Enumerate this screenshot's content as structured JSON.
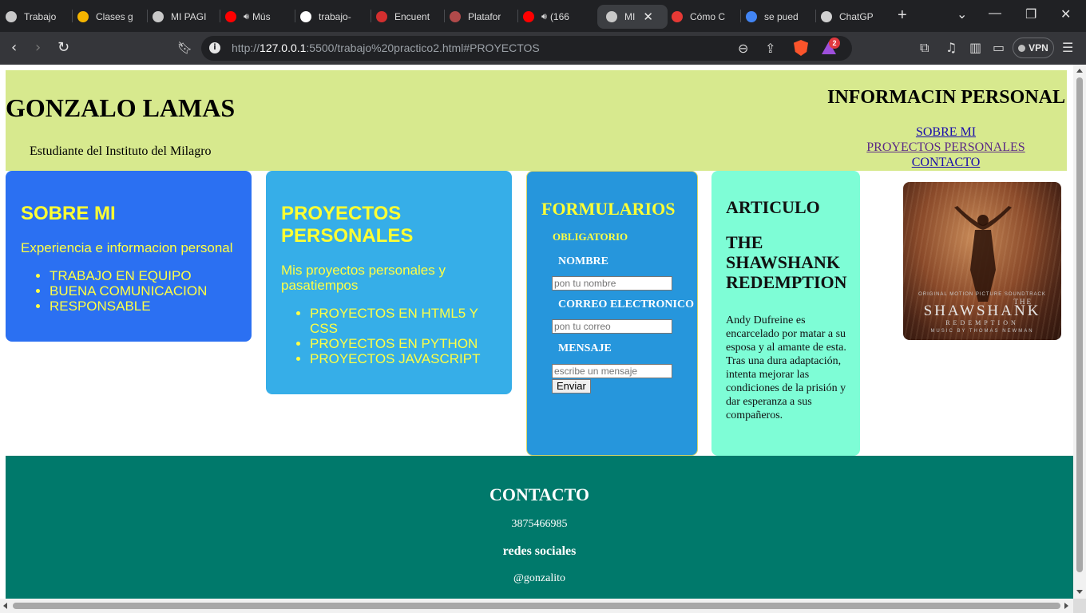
{
  "browser": {
    "tabs": [
      {
        "label": "Trabajo",
        "icon": "globe-icon"
      },
      {
        "label": "Clases g",
        "icon": "google-drive-icon"
      },
      {
        "label": "MI PAGI",
        "icon": "globe-icon"
      },
      {
        "label": "Mús",
        "icon": "youtube-music-icon",
        "audio": true
      },
      {
        "label": "trabajo-",
        "icon": "github-icon"
      },
      {
        "label": "Encuent",
        "icon": "pdf-icon"
      },
      {
        "label": "Platafor",
        "icon": "institution-icon"
      },
      {
        "label": "(166",
        "icon": "youtube-icon",
        "audio": true
      },
      {
        "label": "MI",
        "icon": "globe-icon",
        "active": true
      },
      {
        "label": "Cómo C",
        "icon": "stack-icon"
      },
      {
        "label": "se pued",
        "icon": "google-icon"
      },
      {
        "label": "ChatGP",
        "icon": "chatgpt-icon"
      }
    ],
    "url_prefix": "http://",
    "url_host": "127.0.0.1",
    "url_rest": ":5500/trabajo%20practico2.html#PROYECTOS",
    "rewards_badge": "2",
    "vpn_label": "VPN",
    "colors": {
      "tabbar": "#202124",
      "toolbar": "#35363a",
      "brave": "#fb542b"
    }
  },
  "page": {
    "header": {
      "title": "GONZALO LAMAS",
      "subtitle": "Estudiante del Instituto del Milagro",
      "nav_title": "INFORMACIN PERSONAL",
      "nav_links": [
        "SOBRE MI",
        "PROYECTOS PERSONALES",
        "CONTACTO"
      ],
      "background": "#d7e98e"
    },
    "sobre": {
      "title": "SOBRE MI",
      "lead": "Experiencia e informacion personal",
      "items": [
        "TRABAJO EN EQUIPO",
        "BUENA COMUNICACION",
        "RESPONSABLE"
      ],
      "background": "#2b70f2"
    },
    "proyectos": {
      "title": "PROYECTOS PERSONALES",
      "lead": "Mis proyectos personales y pasatiempos",
      "items": [
        "PROYECTOS EN HTML5 Y CSS",
        "PROYECTOS EN PYTHON",
        "PROYECTOS JAVASCRIPT"
      ],
      "background": "#36aee8"
    },
    "formulario": {
      "title": "FORMULARIOS",
      "obligatorio": "OBLIGATORIO",
      "nombre_label": "NOMBRE",
      "nombre_placeholder": "pon tu nombre",
      "correo_label": "CORREO ELECTRONICO",
      "correo_placeholder": "pon tu correo",
      "mensaje_label": "MENSAJE",
      "mensaje_placeholder": "escribe un mensaje",
      "submit": "Enviar",
      "background": "#2696dc"
    },
    "articulo": {
      "title": "ARTICULO",
      "subtitle": "THE SHAWSHANK REDEMPTION",
      "paragraph1": "Andy Dufreine es encarcelado por matar a su esposa y al amante de esta.",
      "paragraph2": "Tras una dura adaptación, intenta mejorar las condiciones de la prisión y dar esperanza a sus compañeros.",
      "background": "#7efdd6"
    },
    "poster": {
      "top_text": "ORIGINAL MOTION PICTURE SOUNDTRACK",
      "the": "THE",
      "name": "SHAWSHANK",
      "sub": "REDEMPTION",
      "credit": "MUSIC BY THOMAS NEWMAN"
    },
    "footer": {
      "title": "CONTACTO",
      "phone": "3875466985",
      "social_title": "redes sociales",
      "handle": "@gonzalito",
      "background": "#00796b"
    }
  }
}
